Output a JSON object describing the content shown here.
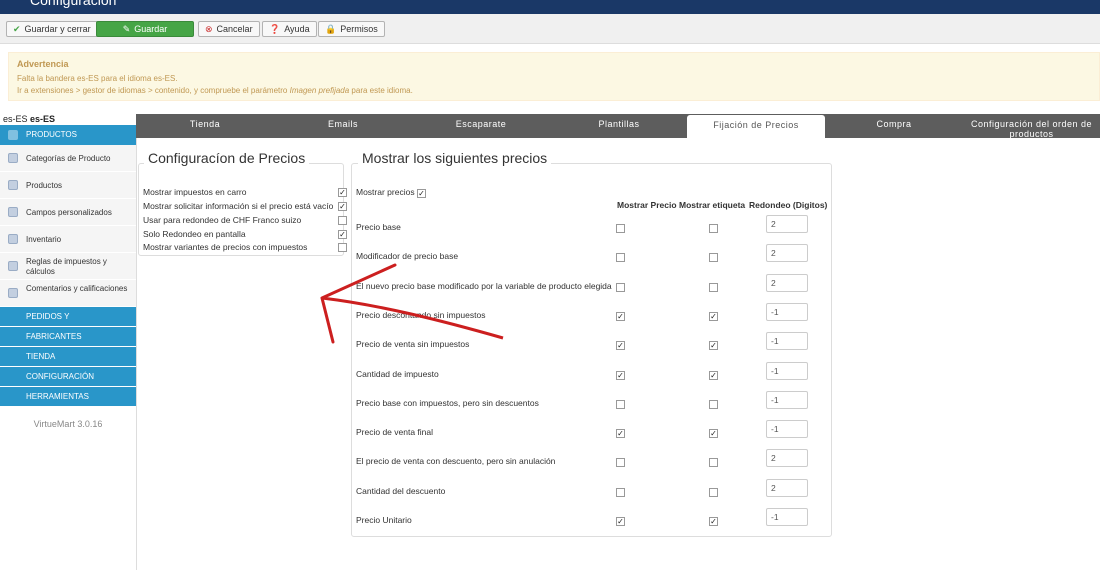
{
  "app": {
    "title": "Configuración"
  },
  "toolbar": {
    "save_close": "Guardar y cerrar",
    "save": "Guardar",
    "cancel": "Cancelar",
    "help": "Ayuda",
    "permissions": "Permisos"
  },
  "alert": {
    "heading": "Advertencia",
    "line1": "Falta la bandera es-ES para el idioma es-ES.",
    "line2_pre": "Ir a extensiones > gestor de idiomas > contenido, y compruebe el parámetro ",
    "line2_em": "Imagen prefijada",
    "line2_post": " para este idioma."
  },
  "lang": {
    "code": "es-ES",
    "bold": "es-ES"
  },
  "sidebar": {
    "header": "PRODUCTOS",
    "items": [
      "Categorías de Producto",
      "Productos",
      "Campos personalizados",
      "Inventario",
      "Reglas de impuestos y cálculos",
      "Comentarios y calificaciones"
    ],
    "sections": [
      "PEDIDOS Y",
      "FABRICANTES",
      "TIENDA",
      "CONFIGURACIÓN",
      "HERRAMIENTAS"
    ],
    "version": "VirtueMart 3.0.16"
  },
  "tabs": [
    "Tienda",
    "Emails",
    "Escaparate",
    "Plantillas",
    "Fijación de Precios",
    "Compra",
    "Configuración del orden de productos"
  ],
  "price_config": {
    "title": "Configuracíon de Precios",
    "rows": [
      {
        "label": "Mostrar impuestos en carro",
        "checked": true
      },
      {
        "label": "Mostrar solicitar información si el precio está vacío",
        "checked": true
      },
      {
        "label": "Usar para redondeo de CHF Franco suizo",
        "checked": false
      },
      {
        "label": "Solo Redondeo en pantalla",
        "checked": true
      },
      {
        "label": "Mostrar variantes de precios con impuestos",
        "checked": false
      }
    ]
  },
  "show_prices": {
    "title": "Mostrar los siguientes precios",
    "toggle_label": "Mostrar precios",
    "toggle_checked": true,
    "col_show_price": "Mostrar Precio",
    "col_show_label": "Mostrar etiqueta",
    "col_rounding": "Redondeo (Digitos)",
    "rows": [
      {
        "label": "Precio base",
        "show": false,
        "tag": false,
        "round": "2"
      },
      {
        "label": "Modificador de precio base",
        "show": false,
        "tag": false,
        "round": "2"
      },
      {
        "label": "El nuevo precio base modificado por la variable de producto elegida",
        "show": false,
        "tag": false,
        "round": "2"
      },
      {
        "label": "Precio descontando sin impuestos",
        "show": true,
        "tag": true,
        "round": "-1"
      },
      {
        "label": "Precio de venta sin impuestos",
        "show": true,
        "tag": true,
        "round": "-1"
      },
      {
        "label": "Cantidad de impuesto",
        "show": true,
        "tag": true,
        "round": "-1"
      },
      {
        "label": "Precio base con impuestos, pero sin descuentos",
        "show": false,
        "tag": false,
        "round": "-1"
      },
      {
        "label": "Precio de venta final",
        "show": true,
        "tag": true,
        "round": "-1"
      },
      {
        "label": "El precio de venta con descuento, pero sin anulación",
        "show": false,
        "tag": false,
        "round": "2"
      },
      {
        "label": "Cantidad del descuento",
        "show": false,
        "tag": false,
        "round": "2"
      },
      {
        "label": "Precio Unitario",
        "show": true,
        "tag": true,
        "round": "-1"
      }
    ]
  },
  "colors": {
    "topbar": "#1a3867",
    "sidebar_active": "#2996c9",
    "tabs": "#5d5d5d",
    "arrow": "#cc1f1f",
    "save_green": "#46a546"
  }
}
